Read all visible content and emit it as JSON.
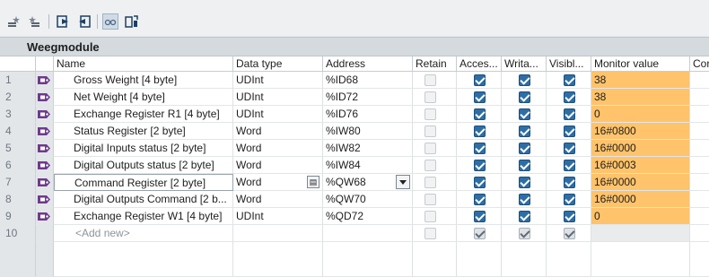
{
  "window": {
    "title": "Weegmodule"
  },
  "toolbar": {
    "buttons": [
      {
        "icon": "star-left-icon"
      },
      {
        "icon": "star-right-icon"
      },
      {
        "icon": "insert-row-icon"
      },
      {
        "icon": "add-row-icon"
      },
      {
        "icon": "monitor-glasses-icon"
      },
      {
        "icon": "modify-value-icon"
      }
    ]
  },
  "columns": {
    "name": "Name",
    "datatype": "Data type",
    "address": "Address",
    "retain": "Retain",
    "access": "Acces...",
    "write": "Writa...",
    "visible": "Visibl...",
    "monitor": "Monitor value",
    "comment": "Cor"
  },
  "rows": [
    {
      "num": "1",
      "name": "Gross Weight [4 byte]",
      "datatype": "UDInt",
      "address": "%ID68",
      "retain": false,
      "access": true,
      "write": true,
      "visible": true,
      "monitor": "38"
    },
    {
      "num": "2",
      "name": "Net Weight [4 byte]",
      "datatype": "UDInt",
      "address": "%ID72",
      "retain": false,
      "access": true,
      "write": true,
      "visible": true,
      "monitor": "38"
    },
    {
      "num": "3",
      "name": "Exchange Register R1 [4 byte]",
      "datatype": "UDInt",
      "address": "%ID76",
      "retain": false,
      "access": true,
      "write": true,
      "visible": true,
      "monitor": "0"
    },
    {
      "num": "4",
      "name": "Status Register [2 byte]",
      "datatype": "Word",
      "address": "%IW80",
      "retain": false,
      "access": true,
      "write": true,
      "visible": true,
      "monitor": "16#0800"
    },
    {
      "num": "5",
      "name": "Digital Inputs status [2 byte]",
      "datatype": "Word",
      "address": "%IW82",
      "retain": false,
      "access": true,
      "write": true,
      "visible": true,
      "monitor": "16#0000"
    },
    {
      "num": "6",
      "name": "Digital Outputs status [2 byte]",
      "datatype": "Word",
      "address": "%IW84",
      "retain": false,
      "access": true,
      "write": true,
      "visible": true,
      "monitor": "16#0003"
    },
    {
      "num": "7",
      "name": "Command Register [2 byte]",
      "datatype": "Word",
      "address": "%QW68",
      "retain": false,
      "access": true,
      "write": true,
      "visible": true,
      "monitor": "16#0000"
    },
    {
      "num": "8",
      "name": "Digital Outputs Command [2 b...",
      "datatype": "Word",
      "address": "%QW70",
      "retain": false,
      "access": true,
      "write": true,
      "visible": true,
      "monitor": "16#0000"
    },
    {
      "num": "9",
      "name": "Exchange Register W1 [4 byte]",
      "datatype": "UDInt",
      "address": "%QD72",
      "retain": false,
      "access": true,
      "write": true,
      "visible": true,
      "monitor": "0"
    }
  ],
  "addnew": {
    "num": "10",
    "label": "<Add new>"
  },
  "colors": {
    "monitor_bg": "#ffc36b",
    "checkbox_on": "#2d6ea6",
    "tag_icon": "#6f3a8c"
  }
}
